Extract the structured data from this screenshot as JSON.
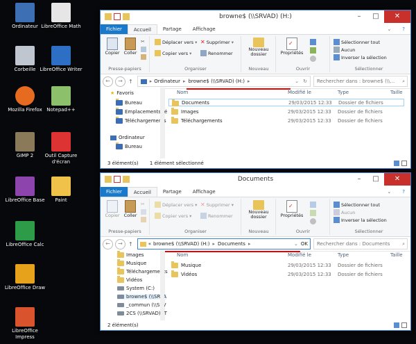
{
  "desktop_icons": [
    {
      "label": "Ordinateur",
      "icon": "computer-icon"
    },
    {
      "label": "LibreOffice Math",
      "icon": "libreoffice-math-icon"
    },
    {
      "label": "Corbeille",
      "icon": "recycle-bin-icon"
    },
    {
      "label": "LibreOffice Writer",
      "icon": "libreoffice-writer-icon"
    },
    {
      "label": "Mozilla Firefox",
      "icon": "firefox-icon"
    },
    {
      "label": "Notepad++",
      "icon": "notepad-plus-icon"
    },
    {
      "label": "GIMP 2",
      "icon": "gimp-icon"
    },
    {
      "label": "Outil Capture d'écran",
      "icon": "snipping-tool-icon"
    },
    {
      "label": "LibreOffice Base",
      "icon": "libreoffice-base-icon"
    },
    {
      "label": "Paint",
      "icon": "paint-icon"
    },
    {
      "label": "LibreOffice Calc",
      "icon": "libreoffice-calc-icon"
    },
    {
      "label": "LibreOffice Draw",
      "icon": "libreoffice-draw-icon"
    },
    {
      "label": "LibreOffice Impress",
      "icon": "libreoffice-impress-icon"
    }
  ],
  "window1": {
    "title": "browne$ (\\\\SRVAD) (H:)",
    "tabs": [
      "Fichier",
      "Accueil",
      "Partage",
      "Affichage"
    ],
    "ribbon": {
      "copier": "Copier",
      "coller": "Coller",
      "presse": "Presse-papiers",
      "deplacer": "Déplacer vers",
      "copier_vers": "Copier vers",
      "supprimer": "Supprimer",
      "renommer": "Renommer",
      "organiser": "Organiser",
      "nouveau_dossier": "Nouveau dossier",
      "nouveau": "Nouveau",
      "proprietes": "Propriétés",
      "ouvrir": "Ouvrir",
      "sel_tout": "Sélectionner tout",
      "aucun": "Aucun",
      "inverser": "Inverser la sélection",
      "selectionner": "Sélectionner"
    },
    "address": {
      "root": "Ordinateur",
      "current": "browne$ (\\\\SRVAD) (H:)"
    },
    "search_placeholder": "Rechercher dans : browne$ (\\\\...",
    "nav": [
      {
        "label": "Favoris",
        "level": 0
      },
      {
        "label": "Bureau",
        "level": 1
      },
      {
        "label": "Emplacements ré",
        "level": 1
      },
      {
        "label": "Téléchargements",
        "level": 1
      },
      {
        "label": "Ordinateur",
        "level": 0
      },
      {
        "label": "Bureau",
        "level": 1
      }
    ],
    "columns": {
      "nom": "Nom",
      "modifie": "Modifié le",
      "type": "Type",
      "taille": "Taille"
    },
    "rows": [
      {
        "name": "Documents",
        "date": "29/03/2015 12:33",
        "type": "Dossier de fichiers"
      },
      {
        "name": "Images",
        "date": "29/03/2015 12:33",
        "type": "Dossier de fichiers"
      },
      {
        "name": "Téléchargements",
        "date": "29/03/2015 12:33",
        "type": "Dossier de fichiers"
      }
    ],
    "status_count": "3 élément(s)",
    "status_sel": "1 élément sélectionné"
  },
  "window2": {
    "title": "Documents",
    "tabs": [
      "Fichier",
      "Accueil",
      "Partage",
      "Affichage"
    ],
    "address": {
      "prefix": "«",
      "parent": "browne$ (\\\\SRVAD) (H:)",
      "current": "Documents",
      "ok": "OK"
    },
    "search_placeholder": "Rechercher dans : Documents",
    "nav": [
      {
        "label": "Images"
      },
      {
        "label": "Musique"
      },
      {
        "label": "Téléchargements"
      },
      {
        "label": "Vidéos"
      },
      {
        "label": "System (C:)"
      },
      {
        "label": "browne$ (\\\\SRVA"
      },
      {
        "label": "_commun (\\\\SRV"
      },
      {
        "label": "2CS (\\\\SRVAD) (T"
      }
    ],
    "columns": {
      "nom": "Nom",
      "modifie": "Modifié le",
      "type": "Type",
      "taille": "Taille"
    },
    "rows": [
      {
        "name": "Musique",
        "date": "29/03/2015 12:33",
        "type": "Dossier de fichiers"
      },
      {
        "name": "Vidéos",
        "date": "29/03/2015 12:33",
        "type": "Dossier de fichiers"
      }
    ],
    "status_count": "2 élément(s)"
  }
}
